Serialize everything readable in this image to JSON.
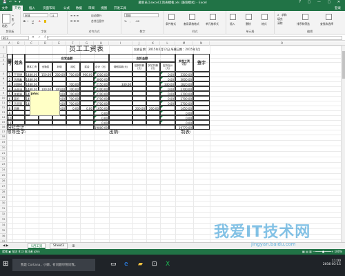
{
  "titlebar": {
    "title": "最新员工excel工资表模板.xls [兼容模式] - Excel",
    "qat": "💾 ↶ ↷ ▾",
    "controls": "? ▢ — ▢ ✕"
  },
  "tabs": [
    "开始",
    "插入",
    "页面布局",
    "公式",
    "数据",
    "审阅",
    "视图",
    "开发工具"
  ],
  "file_tab": "文件",
  "signin": "登录",
  "ribbon": {
    "groups": [
      {
        "label": "剪贴板",
        "items": [
          "粘贴",
          "剪切",
          "复制",
          "格式刷"
        ]
      },
      {
        "label": "字体",
        "font": "宋体",
        "size": "11",
        "items": [
          "B",
          "I",
          "U"
        ]
      },
      {
        "label": "对齐方式",
        "items": [
          "自动换行",
          "合并后居中"
        ]
      },
      {
        "label": "数字",
        "format": "常规",
        "items": [
          "%",
          ",",
          ".00"
        ]
      },
      {
        "label": "样式",
        "items": [
          "条件格式",
          "套用表格格式",
          "单元格样式"
        ]
      },
      {
        "label": "单元格",
        "items": [
          "插入",
          "删除",
          "格式"
        ]
      },
      {
        "label": "编辑",
        "items": [
          "求和",
          "填充",
          "清除",
          "排序和筛选",
          "查找和选择"
        ]
      }
    ]
  },
  "formula": {
    "namebox": "B13",
    "fx": "✕ ✓ fx",
    "value": ""
  },
  "columns": [
    "A",
    "B",
    "C",
    "D",
    "E",
    "F",
    "G",
    "H",
    "I",
    "J",
    "K",
    "L",
    "M",
    "N",
    "O"
  ],
  "rows": [
    "1",
    "2",
    "3",
    "4",
    "5",
    "6",
    "7",
    "8",
    "9",
    "10",
    "11",
    "12",
    "13",
    "14",
    "15",
    "16",
    "17",
    "18",
    "19",
    "20",
    "21",
    "22",
    "23",
    "24",
    "25",
    "26",
    "27",
    "28",
    "29",
    "30",
    "31",
    "32",
    "33",
    "34",
    "35",
    "36",
    "37"
  ],
  "sheet": {
    "title": "员工工资表",
    "date_label": "发放日期：2015年2月12日 所属日期：2015年1月",
    "hdr_no": "编号",
    "hdr_name": "姓名",
    "hdr_pay": "应发金额",
    "hdr_deduct": "应扣金额",
    "hdr_actual": "实发工资（元）",
    "hdr_sign": "签字",
    "sub": [
      "基本工资",
      "全勤奖",
      "补助",
      "岗位",
      "奖金",
      "合计（元）",
      "请假扣款(元)",
      "迟到扣款(元)",
      "其它扣款(元)",
      "应扣合计(元)"
    ],
    "rows": [
      [
        "1",
        "王亚明",
        "1480.00",
        "150.00",
        "200.00",
        "700.00",
        "900.00",
        "3300.00",
        "",
        "",
        "",
        "0.00",
        "3300.00"
      ],
      [
        "2",
        "马国鑫",
        "1480.00",
        "",
        "",
        "",
        "",
        "3000.00",
        "",
        "",
        "",
        "0.00",
        "3000.00"
      ],
      [
        "3",
        "刘国锐",
        "1480.00",
        "",
        "",
        "700.00",
        "",
        "2150.00",
        "330.00",
        "",
        "",
        "330.00",
        "1820.00"
      ],
      [
        "4",
        "马亚涛",
        "1480.00",
        "100.00",
        "100.00",
        "700.00",
        "",
        "2700.00",
        "",
        "",
        "",
        "0.00",
        "2700.00"
      ],
      [
        "5",
        "张爱琴",
        "1480.00",
        "100.00",
        "100.00",
        "700.00",
        "",
        "2700.00",
        "",
        "",
        "",
        "0.00",
        "2700.00"
      ],
      [
        "6",
        "高阳",
        "1480.00",
        "100.00",
        "100.00",
        "700.00",
        "",
        "2700.00",
        "",
        "",
        "",
        "0.00",
        "2700.00"
      ],
      [
        "7",
        "马亚丽",
        "1480.00",
        "100.00",
        "100.00",
        "700.00",
        "",
        "2700.00",
        "",
        "",
        "",
        "0.00",
        "2700.00"
      ],
      [
        "8",
        "司雷",
        "",
        "",
        "100.00",
        "0.00",
        "0.00",
        "1650.00",
        "",
        "200.00",
        "200.00",
        "",
        "1450.00"
      ],
      [
        "9",
        "",
        "",
        "",
        "",
        "",
        "",
        "0.00",
        "",
        "",
        "",
        "",
        "0.00"
      ],
      [
        "10",
        "",
        "",
        "",
        "",
        "",
        "",
        "0.00",
        "",
        "",
        "",
        "",
        "0.00"
      ],
      [
        "11",
        "",
        "",
        "",
        "",
        "",
        "",
        "0.00",
        "",
        "",
        "",
        "",
        "0.00"
      ]
    ],
    "subtotal_label": "分栏合计",
    "subtotal_pay": "19800.00",
    "subtotal_actual": "19770.00",
    "footer_leader": "领导签字:",
    "footer_cashier": "出纳:",
    "footer_maker": "制表:"
  },
  "comment": {
    "author": "john:"
  },
  "sheettabs": [
    "5月工资",
    "Sheet3"
  ],
  "addsheet": "⊕",
  "status": {
    "left": "就绪  ▣ 批注 B13 批注者 john",
    "right": "▦ ▤ ▥  —━━━━●━━━━+  100%"
  },
  "taskbar": {
    "search": "我是 Cortana，小娜。有问题尽管问我。",
    "time": "11:00",
    "date": "2016-03-15"
  },
  "watermark": {
    "line1": "我爱IT技术网",
    "line2": "jingyan.baidu.com"
  },
  "colors": {
    "excel_green": "#217346"
  }
}
